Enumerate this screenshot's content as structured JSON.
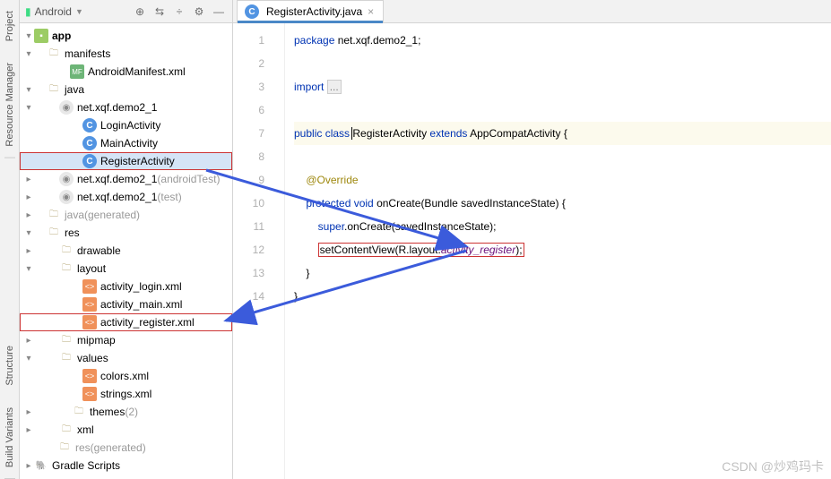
{
  "rails": {
    "project": "Project",
    "resource": "Resource Manager",
    "structure": "Structure",
    "build": "Build Variants"
  },
  "sidebar": {
    "title_icon": "android",
    "title": "Android",
    "buttons": [
      "target",
      "arrows",
      "divide",
      "gear",
      "minimize"
    ],
    "tree": {
      "app": "app",
      "manifests": "manifests",
      "manifest_file": "AndroidManifest.xml",
      "java": "java",
      "pkg1": "net.xqf.demo2_1",
      "login": "LoginActivity",
      "main": "MainActivity",
      "register": "RegisterActivity",
      "pkg2_pre": "net.xqf.demo2_1 ",
      "pkg2_suf": "(androidTest)",
      "pkg3_pre": "net.xqf.demo2_1 ",
      "pkg3_suf": "(test)",
      "java_gen_pre": "java ",
      "java_gen_suf": "(generated)",
      "res": "res",
      "drawable": "drawable",
      "layout": "layout",
      "act_login": "activity_login.xml",
      "act_main": "activity_main.xml",
      "act_register": "activity_register.xml",
      "mipmap": "mipmap",
      "values": "values",
      "colors": "colors.xml",
      "strings": "strings.xml",
      "themes_pre": "themes ",
      "themes_suf": "(2)",
      "xml": "xml",
      "res_gen_pre": "res ",
      "res_gen_suf": "(generated)",
      "gradle": "Gradle Scripts"
    }
  },
  "tab": {
    "label": "RegisterActivity.java",
    "close": "×"
  },
  "gutter": [
    "1",
    "2",
    "3",
    "6",
    "7",
    "8",
    "9",
    "10",
    "11",
    "12",
    "13",
    "14"
  ],
  "code": {
    "l1a": "package ",
    "l1b": "net.xqf.demo2_1;",
    "l3a": "import ",
    "l3b": "...",
    "l5a": "public class ",
    "l5b": "RegisterActivity ",
    "l5c": "extends ",
    "l5d": "AppCompatActivity {",
    "l7": "@Override",
    "l8a": "protected void ",
    "l8b": "onCreate",
    "l8c": "(Bundle savedInstanceState) {",
    "l9a": "super",
    "l9b": ".onCreate(savedInstanceState);",
    "l10a": "setContentView(R.layout.",
    "l10b": "activity_register",
    "l10c": ");",
    "l11": "}",
    "l12": "}"
  },
  "watermark": "CSDN @炒鸡玛卡"
}
